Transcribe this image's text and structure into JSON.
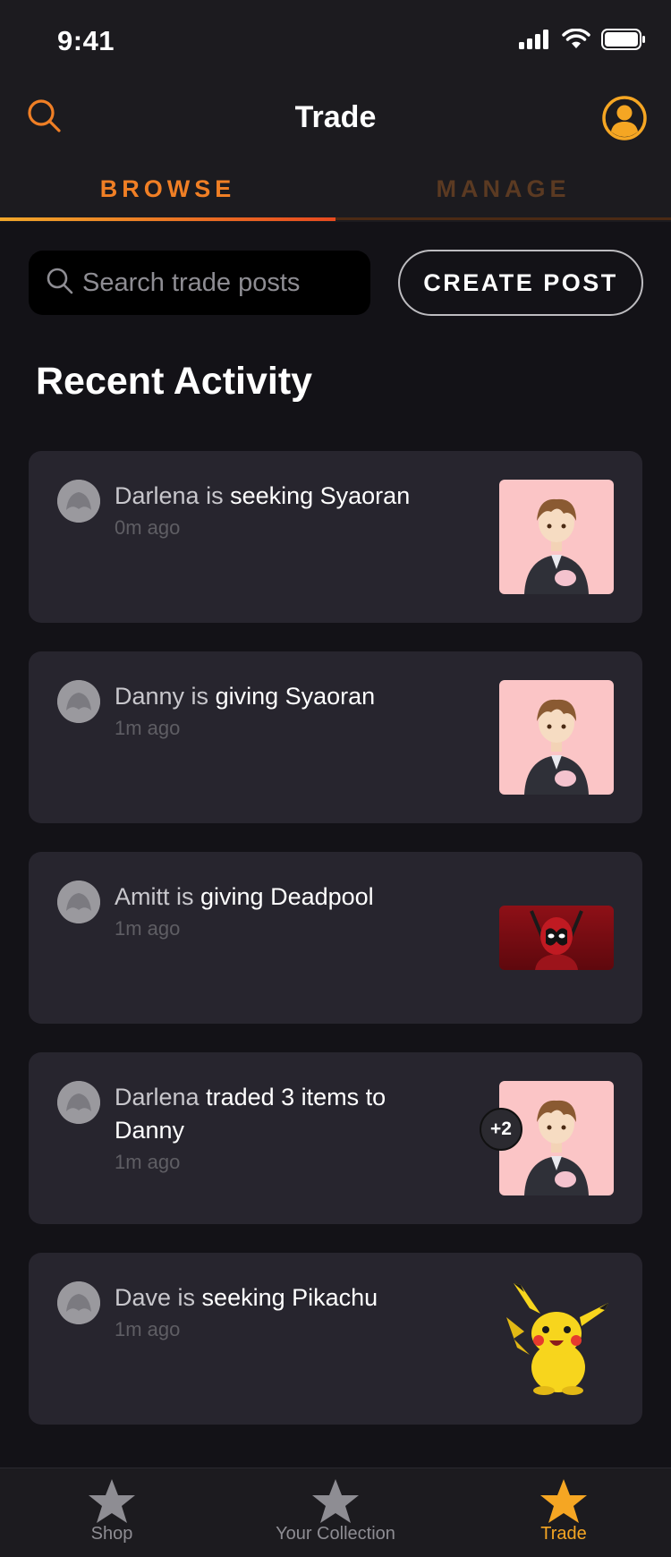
{
  "status_bar": {
    "time": "9:41"
  },
  "header": {
    "title": "Trade",
    "tabs": [
      {
        "label": "BROWSE",
        "active": true
      },
      {
        "label": "MANAGE",
        "active": false
      }
    ]
  },
  "toolbar": {
    "search_placeholder": "Search trade posts",
    "create_post_label": "CREATE POST"
  },
  "section_title": "Recent Activity",
  "activity": [
    {
      "user": "Darlena",
      "verb": " is ",
      "action": "seeking Syaoran",
      "time": "0m ago",
      "thumb": "syaoran"
    },
    {
      "user": "Danny",
      "verb": " is ",
      "action": "giving Syaoran",
      "time": "1m ago",
      "thumb": "syaoran"
    },
    {
      "user": "Amitt",
      "verb": " is ",
      "action": "giving Deadpool",
      "time": "1m ago",
      "thumb": "deadpool"
    },
    {
      "user": "Darlena",
      "verb": " ",
      "action": "traded 3 items to Danny",
      "time": "1m ago",
      "thumb": "syaoran",
      "badge": "+2"
    },
    {
      "user": "Dave",
      "verb": " is ",
      "action": "seeking Pikachu",
      "time": "1m ago",
      "thumb": "pikachu"
    }
  ],
  "tabbar": {
    "items": [
      {
        "label": "Shop",
        "icon": "star-icon",
        "active": false
      },
      {
        "label": "Your Collection",
        "icon": "star-icon",
        "active": false
      },
      {
        "label": "Trade",
        "icon": "star-icon",
        "active": true
      }
    ]
  },
  "colors": {
    "accent": "#f07f25",
    "background": "#131217",
    "card": "#27252e",
    "active_tab": "#f5a623",
    "inactive_tab": "#8e8d93"
  }
}
